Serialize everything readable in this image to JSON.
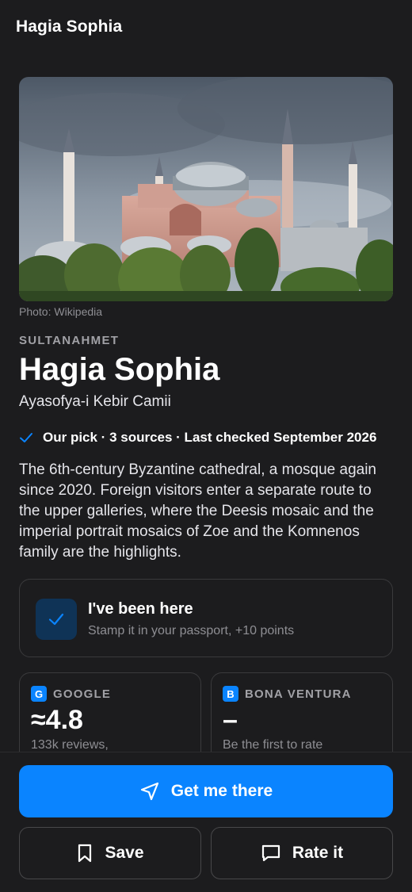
{
  "header": {
    "title": "Hagia Sophia"
  },
  "hero": {
    "credit": "Photo: Wikipedia"
  },
  "place": {
    "district": "SULTANAHMET",
    "name": "Hagia Sophia",
    "alt_name": "Ayasofya-i Kebir Camii",
    "pick_line": "Our pick · 3 sources · Last checked September 2026",
    "description": "The 6th-century Byzantine cathedral, a mosque again since 2020. Foreign visitors enter a separate route to the upper galleries, where the Deesis mosaic and the imperial portrait mosaics of Zoe and the Komnenos family are the highlights."
  },
  "visited": {
    "title": "I've been here",
    "subtitle": "Stamp it in your passport, +10 points"
  },
  "ratings": [
    {
      "badge": "G",
      "source": "GOOGLE",
      "score": "≈4.8",
      "note": "133k reviews,"
    },
    {
      "badge": "B",
      "source": "BONA VENTURA",
      "score": "–",
      "note": "Be the first to rate"
    }
  ],
  "actions": {
    "primary": "Get me there",
    "save": "Save",
    "rate": "Rate it"
  },
  "colors": {
    "accent": "#0a84ff",
    "background": "#1c1c1e",
    "card_border": "#3a3a3c"
  }
}
